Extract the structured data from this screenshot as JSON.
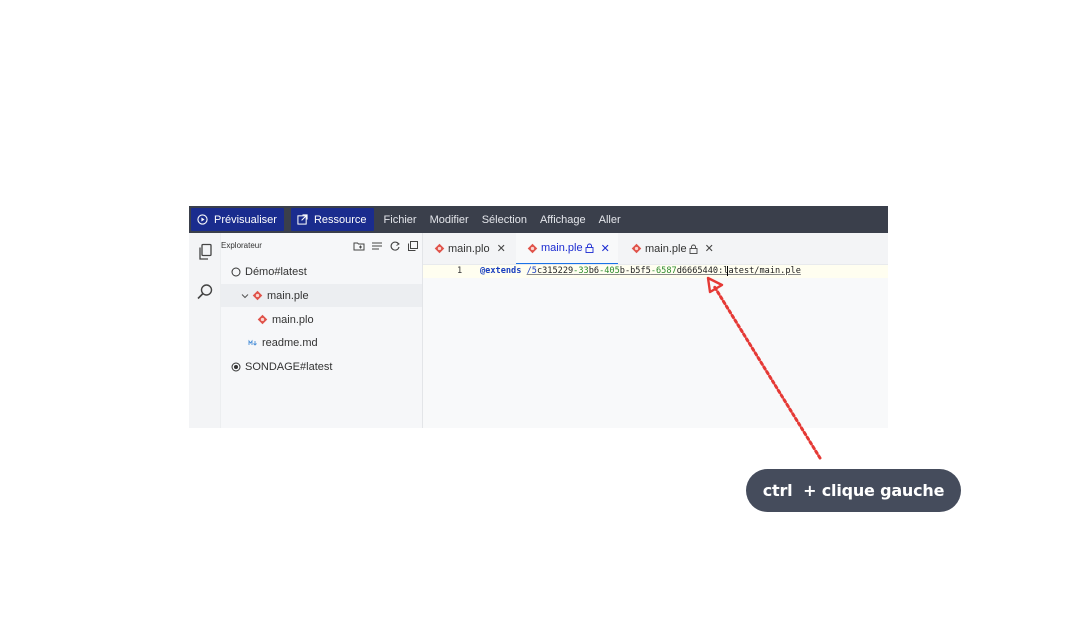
{
  "topbar": {
    "preview_label": "Prévisualiser",
    "resource_label": "Ressource",
    "menu": [
      "Fichier",
      "Modifier",
      "Sélection",
      "Affichage",
      "Aller"
    ]
  },
  "sidebar": {
    "title": "Explorateur",
    "tree": [
      {
        "label": "Démo#latest"
      },
      {
        "label": "main.ple"
      },
      {
        "label": "main.plo"
      },
      {
        "label": "readme.md"
      },
      {
        "label": "SONDAGE#latest"
      }
    ]
  },
  "editor": {
    "tabs": [
      {
        "label": "main.plo"
      },
      {
        "label": "main.ple"
      },
      {
        "label": "main.ple"
      }
    ],
    "line_number": "1",
    "code": {
      "keyword": "@extends",
      "path_parts": [
        "/5",
        "c315229",
        "-33",
        "b6",
        "-405",
        "b-b5f5",
        "-6587",
        "d6665440:l",
        "atest/main.ple"
      ]
    }
  },
  "hint": {
    "text": "ctrl  + clique gauche"
  },
  "colors": {
    "topbar_bg": "#3a3f4b",
    "button_bg": "#1a2c8e",
    "active_tab_text": "#1b2bd1",
    "ple_icon": "#e0534a",
    "arrow": "#e53935",
    "hint_bg": "#454c5c"
  },
  "icons": [
    "play-circle-icon",
    "external-link-icon",
    "files-icon",
    "search-icon",
    "new-folder-icon",
    "collapse-icon",
    "refresh-icon",
    "copy-icon",
    "circle-icon",
    "radio-selected-icon",
    "chevron-down-icon",
    "ple-file-icon",
    "markdown-icon",
    "lock-icon",
    "close-icon"
  ]
}
